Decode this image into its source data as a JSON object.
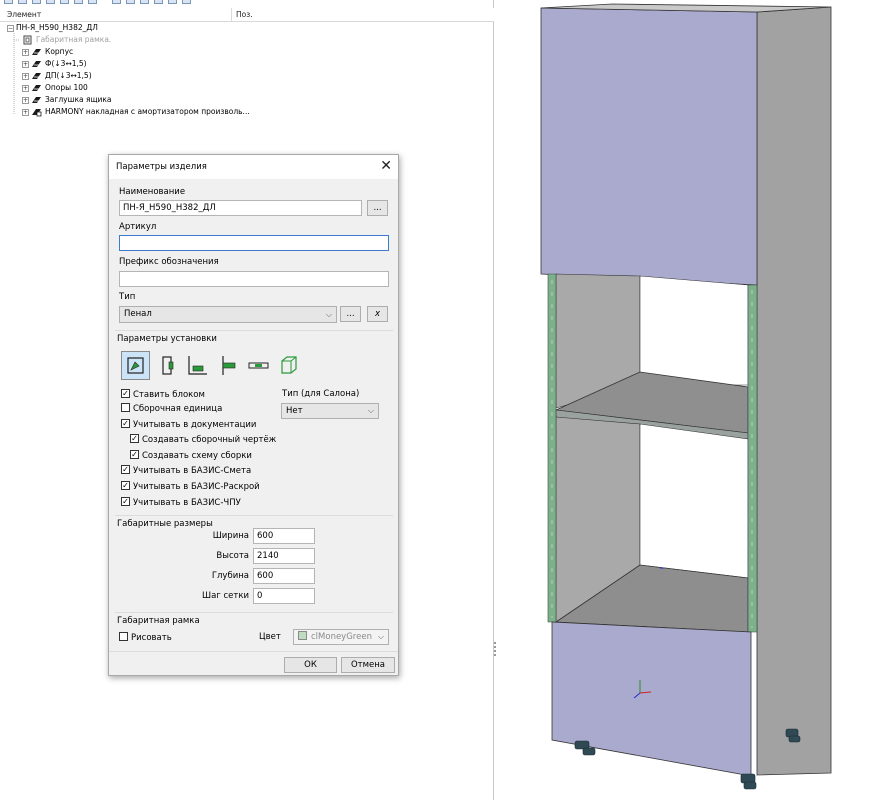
{
  "tree": {
    "columns": {
      "element": "Элемент",
      "position": "Поз."
    },
    "root": "ПН-Я_Н590_Н382_ДЛ",
    "items": [
      {
        "label": "Габаритная рамка.",
        "dim": true,
        "expandable": false
      },
      {
        "label": "Корпус",
        "dim": false,
        "expandable": true
      },
      {
        "label": "Ф(↓3↔1,5)",
        "dim": false,
        "expandable": true
      },
      {
        "label": "ДП(↓3↔1,5)",
        "dim": false,
        "expandable": true
      },
      {
        "label": "Опоры 100",
        "dim": false,
        "expandable": true
      },
      {
        "label": "Заглушка ящика",
        "dim": false,
        "expandable": true
      },
      {
        "label": "HARMONY накладная с амортизатором произволь...",
        "dim": false,
        "expandable": true
      }
    ]
  },
  "dialog": {
    "title": "Параметры изделия",
    "name_label": "Наименование",
    "name_value": "ПН-Я_Н590_Н382_ДЛ",
    "browse_label": "...",
    "article_label": "Артикул",
    "article_value": "",
    "prefix_label": "Префикс обозначения",
    "prefix_value": "",
    "type_label": "Тип",
    "type_value": "Пенал",
    "type_more_label": "...",
    "type_clear_label": "x",
    "install_group": "Параметры установки",
    "checks": [
      {
        "label": "Ставить блоком",
        "checked": true
      },
      {
        "label": "Сборочная единица",
        "checked": false
      },
      {
        "label": "Учитывать в документации",
        "checked": true
      },
      {
        "label": "Создавать сборочный чертёж",
        "checked": true
      },
      {
        "label": "Создавать схему сборки",
        "checked": true
      },
      {
        "label": "Учитывать в БАЗИС-Смета",
        "checked": true
      },
      {
        "label": "Учитывать в БАЗИС-Раскрой",
        "checked": true
      },
      {
        "label": "Учитывать в БАЗИС-ЧПУ",
        "checked": true
      }
    ],
    "salon_type_label": "Тип (для Салона)",
    "salon_type_value": "Нет",
    "dims_group": "Габаритные размеры",
    "width_label": "Ширина",
    "width_value": "600",
    "height_label": "Высота",
    "height_value": "2140",
    "depth_label": "Глубина",
    "depth_value": "600",
    "grid_label": "Шаг сетки",
    "grid_value": "0",
    "frame_group": "Габаритная рамка",
    "draw_label": "Рисовать",
    "draw_checked": false,
    "color_label": "Цвет",
    "color_value": "clMoneyGreen",
    "ok_label": "ОК",
    "cancel_label": "Отмена"
  },
  "colors": {
    "cabinet_front": "#a9a9cf",
    "cabinet_side": "#a4a4a4",
    "cabinet_top": "#c8c8c8",
    "edge_band": "#7fb08c",
    "accent": "#3e7ad0"
  }
}
